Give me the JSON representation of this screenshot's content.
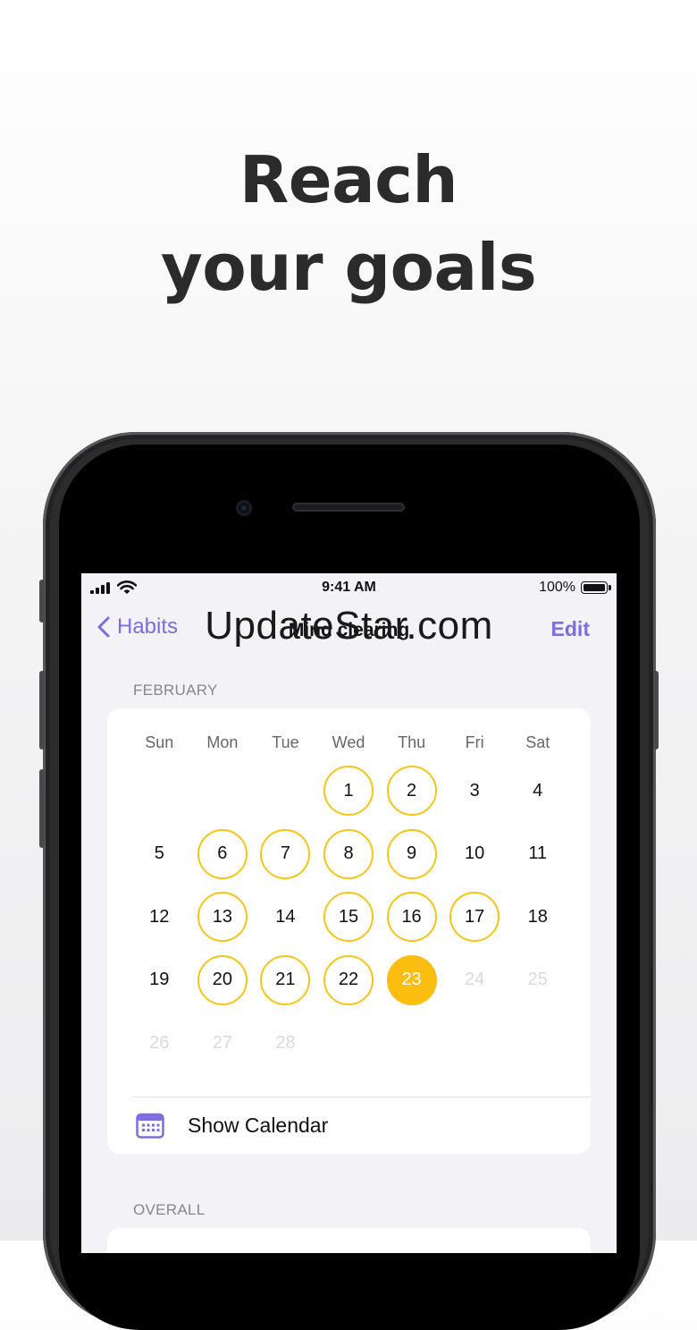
{
  "headline": {
    "line1": "Reach",
    "line2": "your goals"
  },
  "status_bar": {
    "time": "9:41 AM",
    "battery": "100%"
  },
  "nav": {
    "back_label": "Habits",
    "title": "Mind clearing",
    "edit_label": "Edit"
  },
  "watermark": "UpdateStar.com",
  "calendar": {
    "month": "FEBRUARY",
    "weekdays": [
      "Sun",
      "Mon",
      "Tue",
      "Wed",
      "Thu",
      "Fri",
      "Sat"
    ],
    "start_weekday_index": 3,
    "days": [
      {
        "n": "1",
        "s": "done"
      },
      {
        "n": "2",
        "s": "done"
      },
      {
        "n": "3",
        "s": "plain"
      },
      {
        "n": "4",
        "s": "plain"
      },
      {
        "n": "5",
        "s": "plain"
      },
      {
        "n": "6",
        "s": "done"
      },
      {
        "n": "7",
        "s": "done"
      },
      {
        "n": "8",
        "s": "done"
      },
      {
        "n": "9",
        "s": "done"
      },
      {
        "n": "10",
        "s": "plain"
      },
      {
        "n": "11",
        "s": "plain"
      },
      {
        "n": "12",
        "s": "plain"
      },
      {
        "n": "13",
        "s": "done"
      },
      {
        "n": "14",
        "s": "plain"
      },
      {
        "n": "15",
        "s": "done"
      },
      {
        "n": "16",
        "s": "done"
      },
      {
        "n": "17",
        "s": "done"
      },
      {
        "n": "18",
        "s": "plain"
      },
      {
        "n": "19",
        "s": "plain"
      },
      {
        "n": "20",
        "s": "done"
      },
      {
        "n": "21",
        "s": "done"
      },
      {
        "n": "22",
        "s": "done"
      },
      {
        "n": "23",
        "s": "today"
      },
      {
        "n": "24",
        "s": "future"
      },
      {
        "n": "25",
        "s": "future"
      },
      {
        "n": "26",
        "s": "future"
      },
      {
        "n": "27",
        "s": "future"
      },
      {
        "n": "28",
        "s": "future"
      }
    ],
    "show_calendar_label": "Show Calendar"
  },
  "overall_label": "OVERALL",
  "colors": {
    "accent": "#7c6ee0",
    "done_ring": "#f5c518",
    "today_fill": "#fbbd0f"
  },
  "icons": {
    "back": "chevron-left-icon",
    "calendar": "calendar-icon",
    "signal": "signal-icon",
    "wifi": "wifi-icon",
    "battery": "battery-icon"
  }
}
